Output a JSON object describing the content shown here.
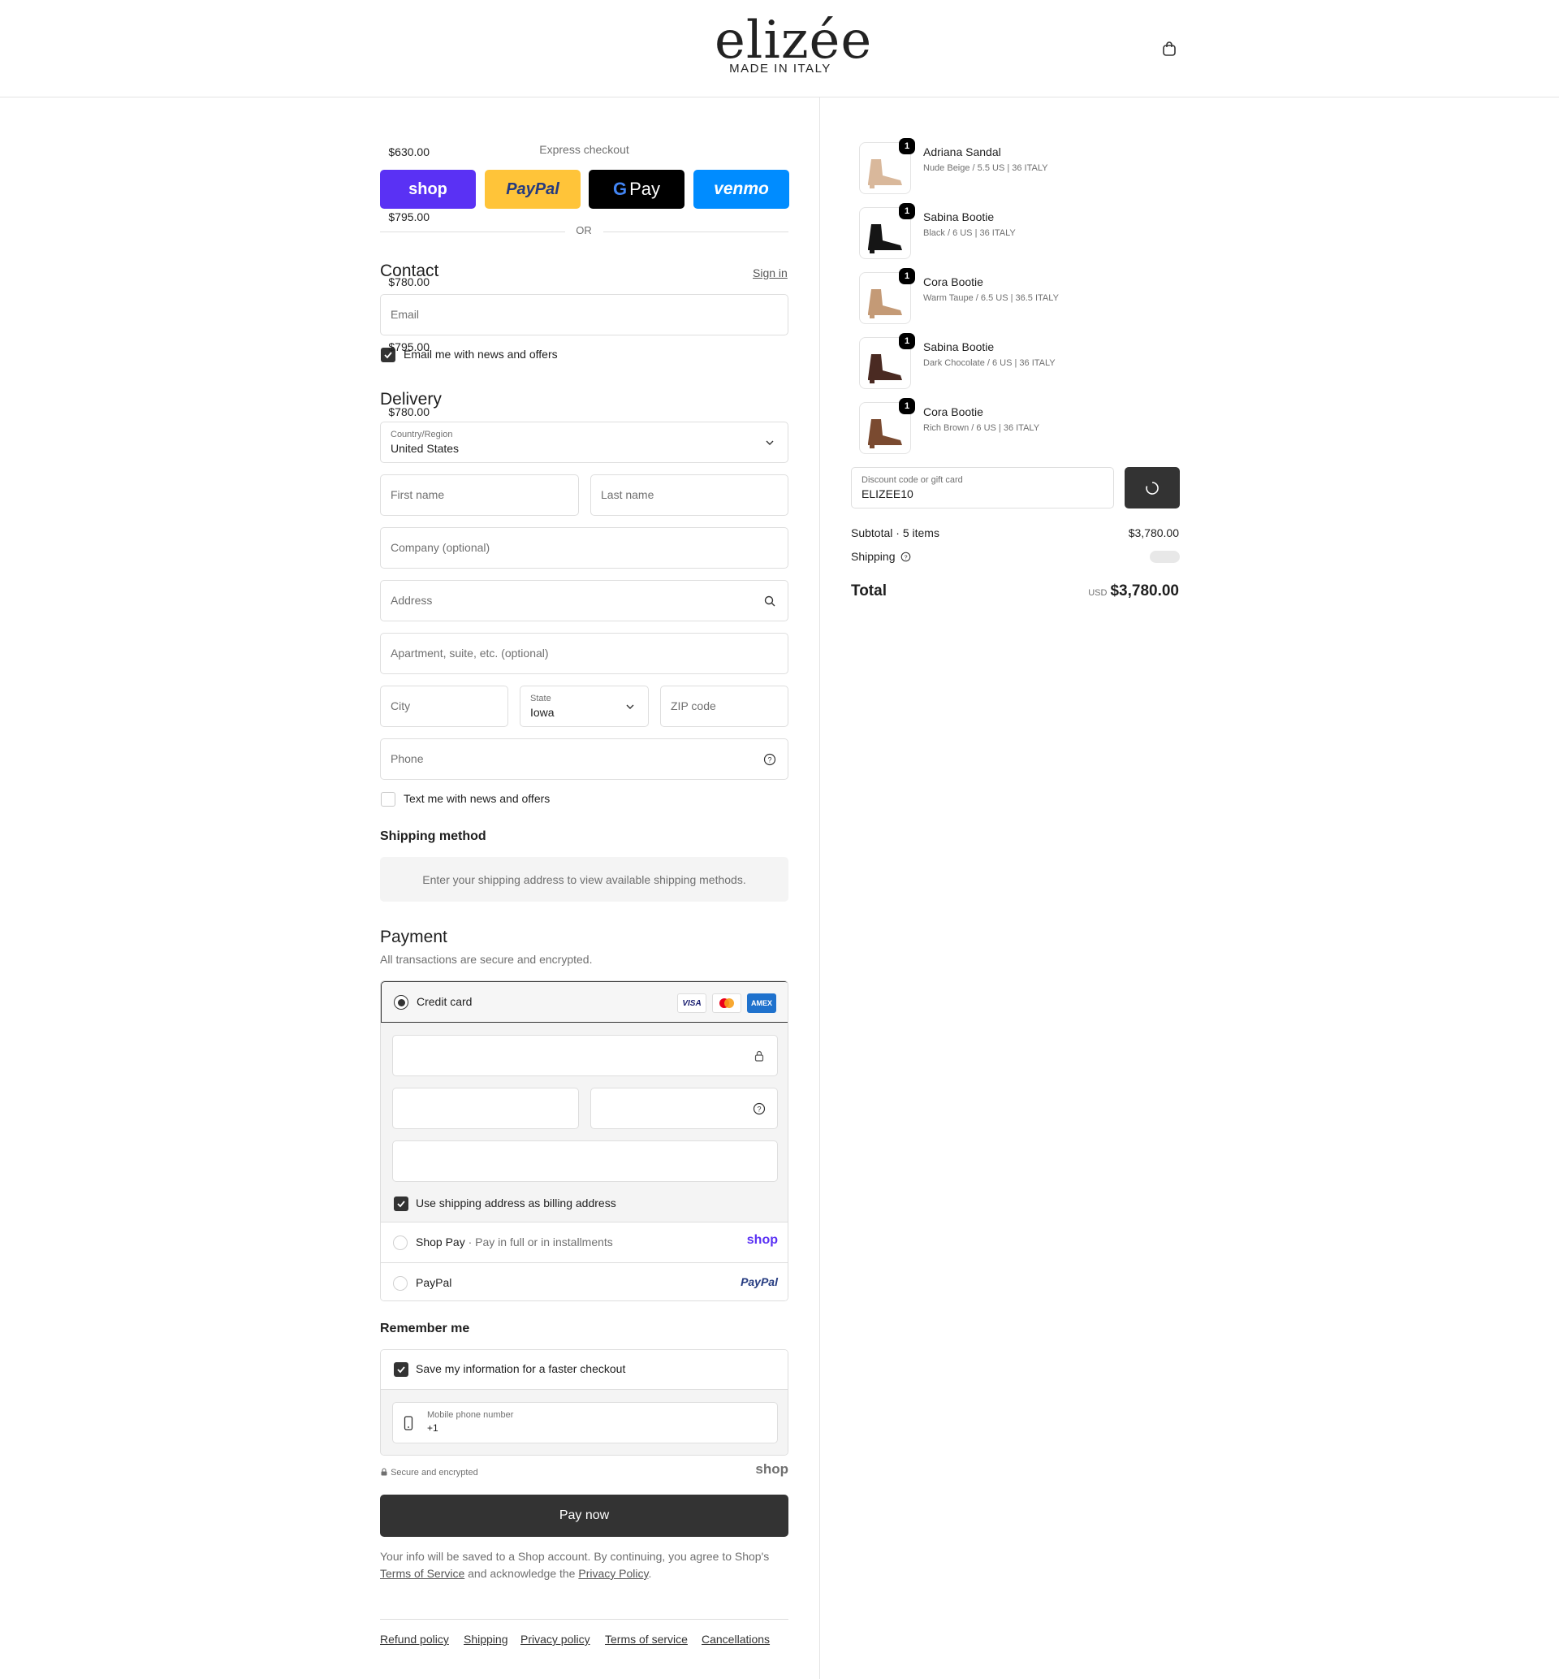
{
  "header": {
    "logo_main": "elizée",
    "logo_sub": "MADE IN ITALY",
    "cart_icon": "shopping-bag-icon"
  },
  "express": {
    "title": "Express checkout",
    "buttons": [
      {
        "label": "shop",
        "color": "#5a31f4",
        "text_color": "#ffffff"
      },
      {
        "label": "PayPal",
        "color": "#ffc439",
        "text_color": "#253b80"
      },
      {
        "label": "Pay",
        "color": "#000000",
        "text_color": "#ffffff"
      },
      {
        "label": "venmo",
        "color": "#008cff",
        "text_color": "#ffffff"
      }
    ],
    "or": "OR"
  },
  "contact": {
    "heading": "Contact",
    "sign_in": "Sign in",
    "email_placeholder": "Email",
    "news_label": "Email me with news and offers",
    "news_checked": true
  },
  "delivery": {
    "heading": "Delivery",
    "country_label": "Country/Region",
    "country_value": "United States",
    "first_name": "First name",
    "last_name": "Last name",
    "company": "Company (optional)",
    "address": "Address",
    "apartment": "Apartment, suite, etc. (optional)",
    "city": "City",
    "state_label": "State",
    "state_value": "Iowa",
    "zip": "ZIP code",
    "phone": "Phone",
    "text_label": "Text me with news and offers",
    "text_checked": false
  },
  "shipping": {
    "heading": "Shipping method",
    "message": "Enter your shipping address to view available shipping methods."
  },
  "payment": {
    "heading": "Payment",
    "subtitle": "All transactions are secure and encrypted.",
    "credit_card": "Credit card",
    "card_brands": [
      "VISA",
      "mastercard",
      "AMEX"
    ],
    "billing_label": "Use shipping address as billing address",
    "billing_checked": true,
    "shop_pay": "Shop Pay",
    "shop_pay_sub": "Pay in full or in installments",
    "shop_pay_logo": "shop",
    "paypal": "PayPal",
    "paypal_logo": "PayPal"
  },
  "remember": {
    "heading": "Remember me",
    "save_label": "Save my information for a faster checkout",
    "save_checked": true,
    "mobile_label": "Mobile phone number",
    "mobile_value": "+1",
    "secure": "Secure and encrypted",
    "shop_logo": "shop"
  },
  "pay_now": "Pay now",
  "legal": {
    "line1": "Your info will be saved to a Shop account. By continuing, you agree to Shop's",
    "terms": "Terms of Service",
    "and": "and acknowledge the",
    "privacy": "Privacy Policy",
    "end": "."
  },
  "footer_links": [
    "Refund policy",
    "Shipping",
    "Privacy policy",
    "Terms of service",
    "Cancellations"
  ],
  "cart": {
    "items": [
      {
        "name": "Adriana Sandal",
        "variant": "Nude Beige / 5.5 US | 36 ITALY",
        "price": "$630.00",
        "qty": "1",
        "color": "#d9b89b"
      },
      {
        "name": "Sabina Bootie",
        "variant": "Black / 6 US | 36 ITALY",
        "price": "$795.00",
        "qty": "1",
        "color": "#151515"
      },
      {
        "name": "Cora Bootie",
        "variant": "Warm Taupe / 6.5 US | 36.5 ITALY",
        "price": "$780.00",
        "qty": "1",
        "color": "#c49a76"
      },
      {
        "name": "Sabina Bootie",
        "variant": "Dark Chocolate / 6 US | 36 ITALY",
        "price": "$795.00",
        "qty": "1",
        "color": "#4a2a22"
      },
      {
        "name": "Cora Bootie",
        "variant": "Rich Brown / 6 US | 36 ITALY",
        "price": "$780.00",
        "qty": "1",
        "color": "#7a4a30"
      }
    ],
    "discount_label": "Discount code or gift card",
    "discount_value": "ELIZEE10",
    "subtotal_label": "Subtotal · 5 items",
    "subtotal_value": "$3,780.00",
    "shipping_label": "Shipping",
    "total_label": "Total",
    "currency": "USD",
    "total_value": "$3,780.00"
  }
}
